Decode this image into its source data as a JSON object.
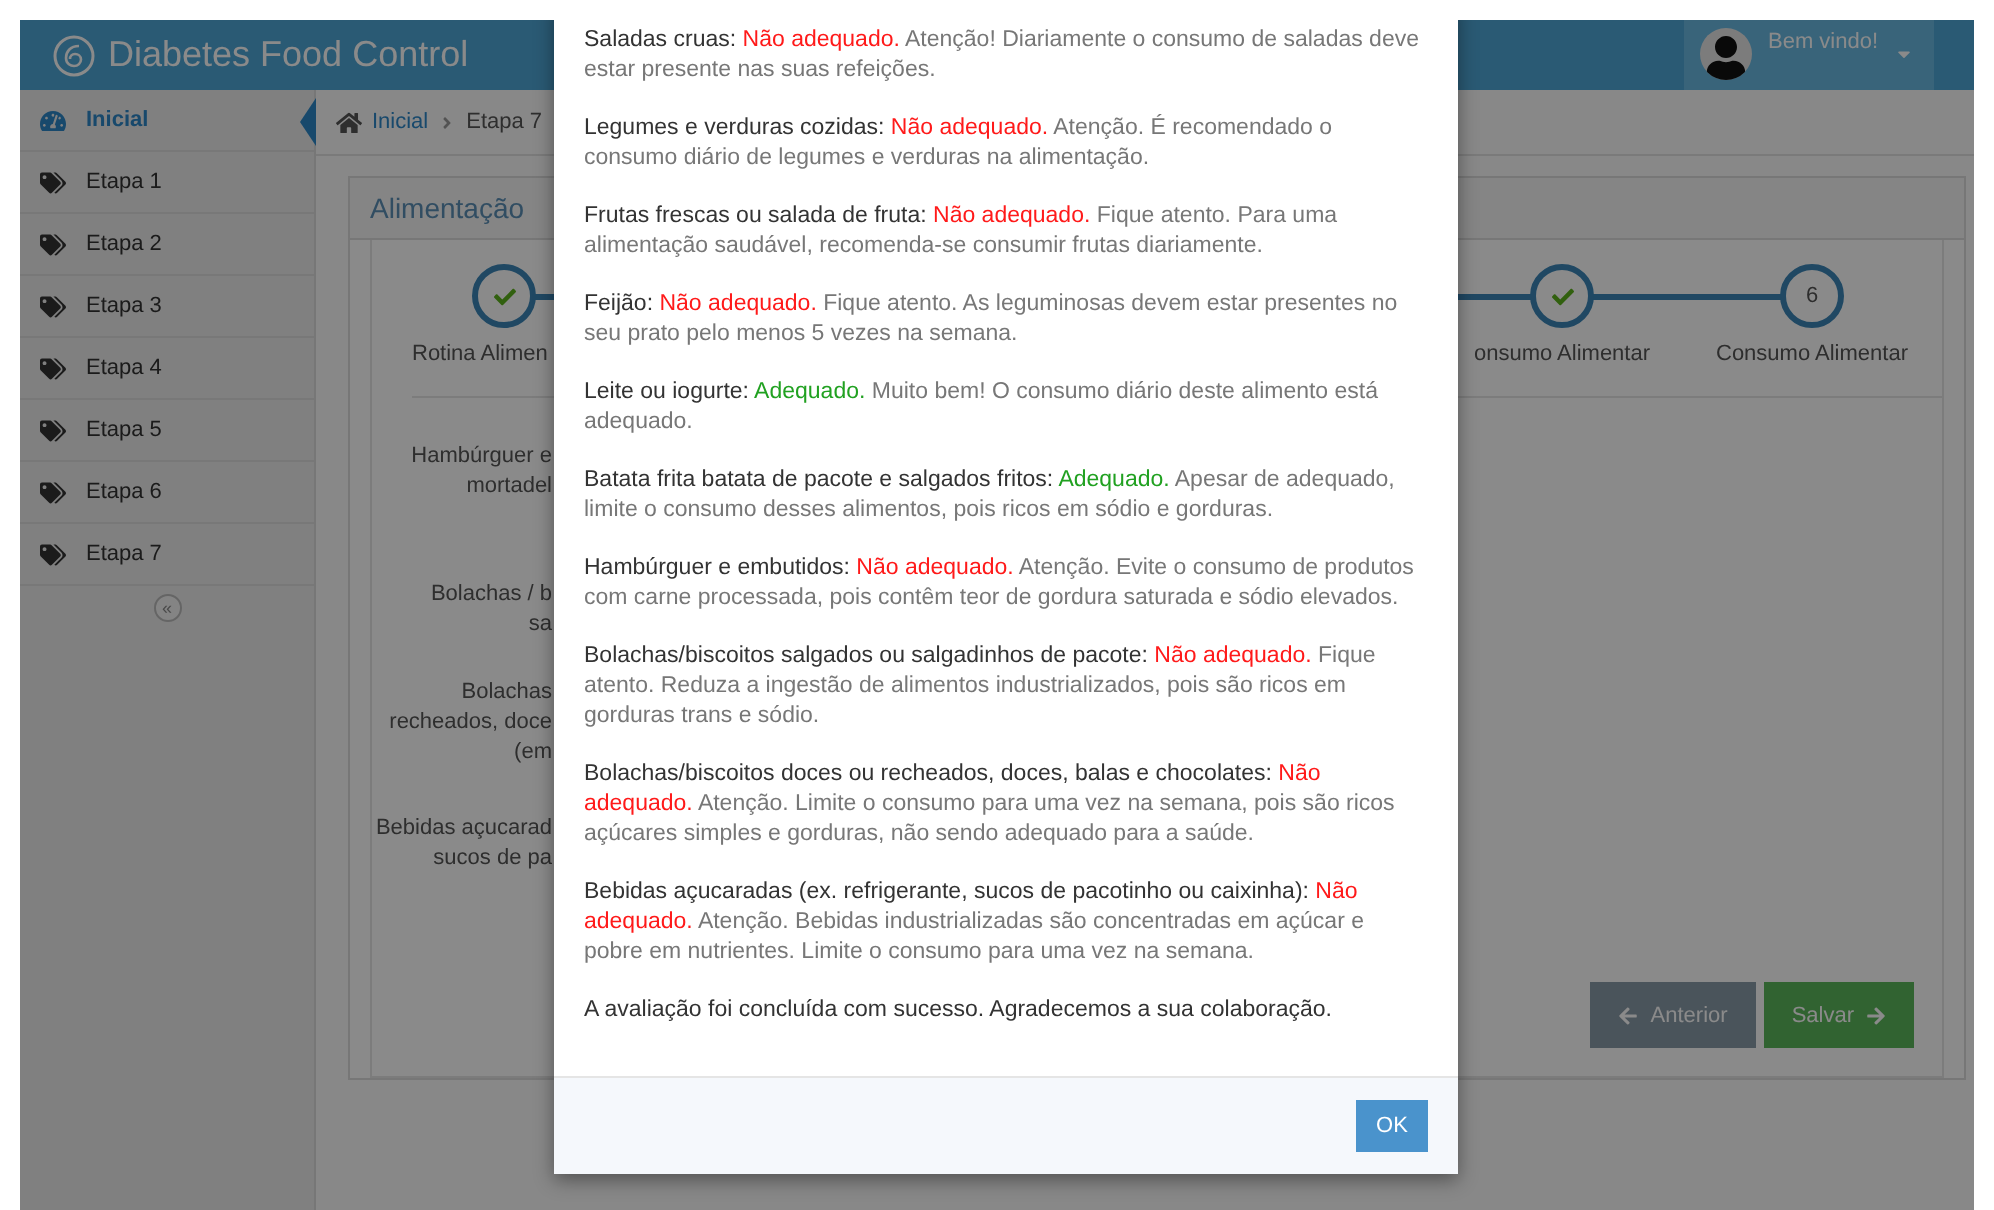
{
  "header": {
    "title": "Diabetes Food Control",
    "user_greeting": "Bem vindo!"
  },
  "sidebar": {
    "items": [
      {
        "label": "Inicial",
        "kind": "dashboard",
        "selected": true
      },
      {
        "label": "Etapa 1",
        "kind": "tag",
        "selected": false
      },
      {
        "label": "Etapa 2",
        "kind": "tag",
        "selected": false
      },
      {
        "label": "Etapa 3",
        "kind": "tag",
        "selected": false
      },
      {
        "label": "Etapa 4",
        "kind": "tag",
        "selected": false
      },
      {
        "label": "Etapa 5",
        "kind": "tag",
        "selected": false
      },
      {
        "label": "Etapa 6",
        "kind": "tag",
        "selected": false
      },
      {
        "label": "Etapa 7",
        "kind": "tag",
        "selected": false
      }
    ],
    "collapse": "«"
  },
  "breadcrumb": [
    "Inicial",
    "Etapa 7"
  ],
  "panel": {
    "title": "Alimentação",
    "left_step": {
      "done": true,
      "label": "Rotina Alimen"
    },
    "right_steps": [
      {
        "done": true,
        "label": "onsumo Alimentar"
      },
      {
        "done": false,
        "number": "6",
        "label": "Consumo Alimentar"
      }
    ],
    "questions": [
      {
        "lines": [
          "Hambúrguer e",
          "mortadel"
        ]
      },
      {
        "lines": [
          "Bolachas / b",
          "sa"
        ]
      },
      {
        "lines": [
          "Bolachas",
          "recheados, doce",
          "(em"
        ]
      },
      {
        "lines": [
          "Bebidas açucarad",
          "sucos de pa"
        ]
      }
    ],
    "buttons": [
      {
        "label": "Anterior",
        "kind": "previous"
      },
      {
        "label": "Salvar",
        "kind": "save"
      }
    ]
  },
  "modal": {
    "items": [
      {
        "label": "Saladas cruas:",
        "adequate": false,
        "verdict": "Não adequado.",
        "message": "Atenção! Diariamente o consumo de saladas deve estar presente nas suas refeições."
      },
      {
        "label": "Legumes e verduras cozidas:",
        "adequate": false,
        "verdict": "Não adequado.",
        "message": "Atenção. É recomendado o consumo diário de legumes e verduras na alimentação."
      },
      {
        "label": "Frutas frescas ou salada de fruta:",
        "adequate": false,
        "verdict": "Não adequado.",
        "message": "Fique atento. Para uma alimentação saudável, recomenda-se consumir frutas diariamente."
      },
      {
        "label": "Feijão:",
        "adequate": false,
        "verdict": "Não adequado.",
        "message": "Fique atento. As leguminosas devem estar presentes no seu prato pelo menos 5 vezes na semana."
      },
      {
        "label": "Leite ou iogurte:",
        "adequate": true,
        "verdict": "Adequado.",
        "message": "Muito bem! O consumo diário deste alimento está adequado."
      },
      {
        "label": "Batata frita batata de pacote e salgados fritos:",
        "adequate": true,
        "verdict": "Adequado.",
        "message": "Apesar de adequado, limite o consumo desses alimentos, pois ricos em sódio e gorduras."
      },
      {
        "label": "Hambúrguer e embutidos:",
        "adequate": false,
        "verdict": "Não adequado.",
        "message": "Atenção. Evite o consumo de produtos com carne processada, pois contêm teor de gordura saturada e sódio elevados."
      },
      {
        "label": "Bolachas/biscoitos salgados ou salgadinhos de pacote:",
        "adequate": false,
        "verdict": "Não adequado.",
        "message": "Fique atento. Reduza a ingestão de alimentos industrializados, pois são ricos em gorduras trans e sódio."
      },
      {
        "label": "Bolachas/biscoitos doces ou recheados, doces, balas e chocolates:",
        "adequate": false,
        "verdict": "Não adequado.",
        "message": "Atenção. Limite o consumo para uma vez na semana, pois são ricos açúcares simples e gorduras, não sendo adequado para a saúde."
      },
      {
        "label": "Bebidas açucaradas (ex. refrigerante, sucos de pacotinho ou caixinha):",
        "adequate": false,
        "verdict": "Não adequado.",
        "message": "Atenção. Bebidas industrializadas são concentradas em açúcar e pobre em nutrientes. Limite o consumo para uma vez na semana."
      }
    ],
    "closing": "A avaliação foi concluída com sucesso. Agradecemos a sua colaboração.",
    "ok": "OK"
  }
}
